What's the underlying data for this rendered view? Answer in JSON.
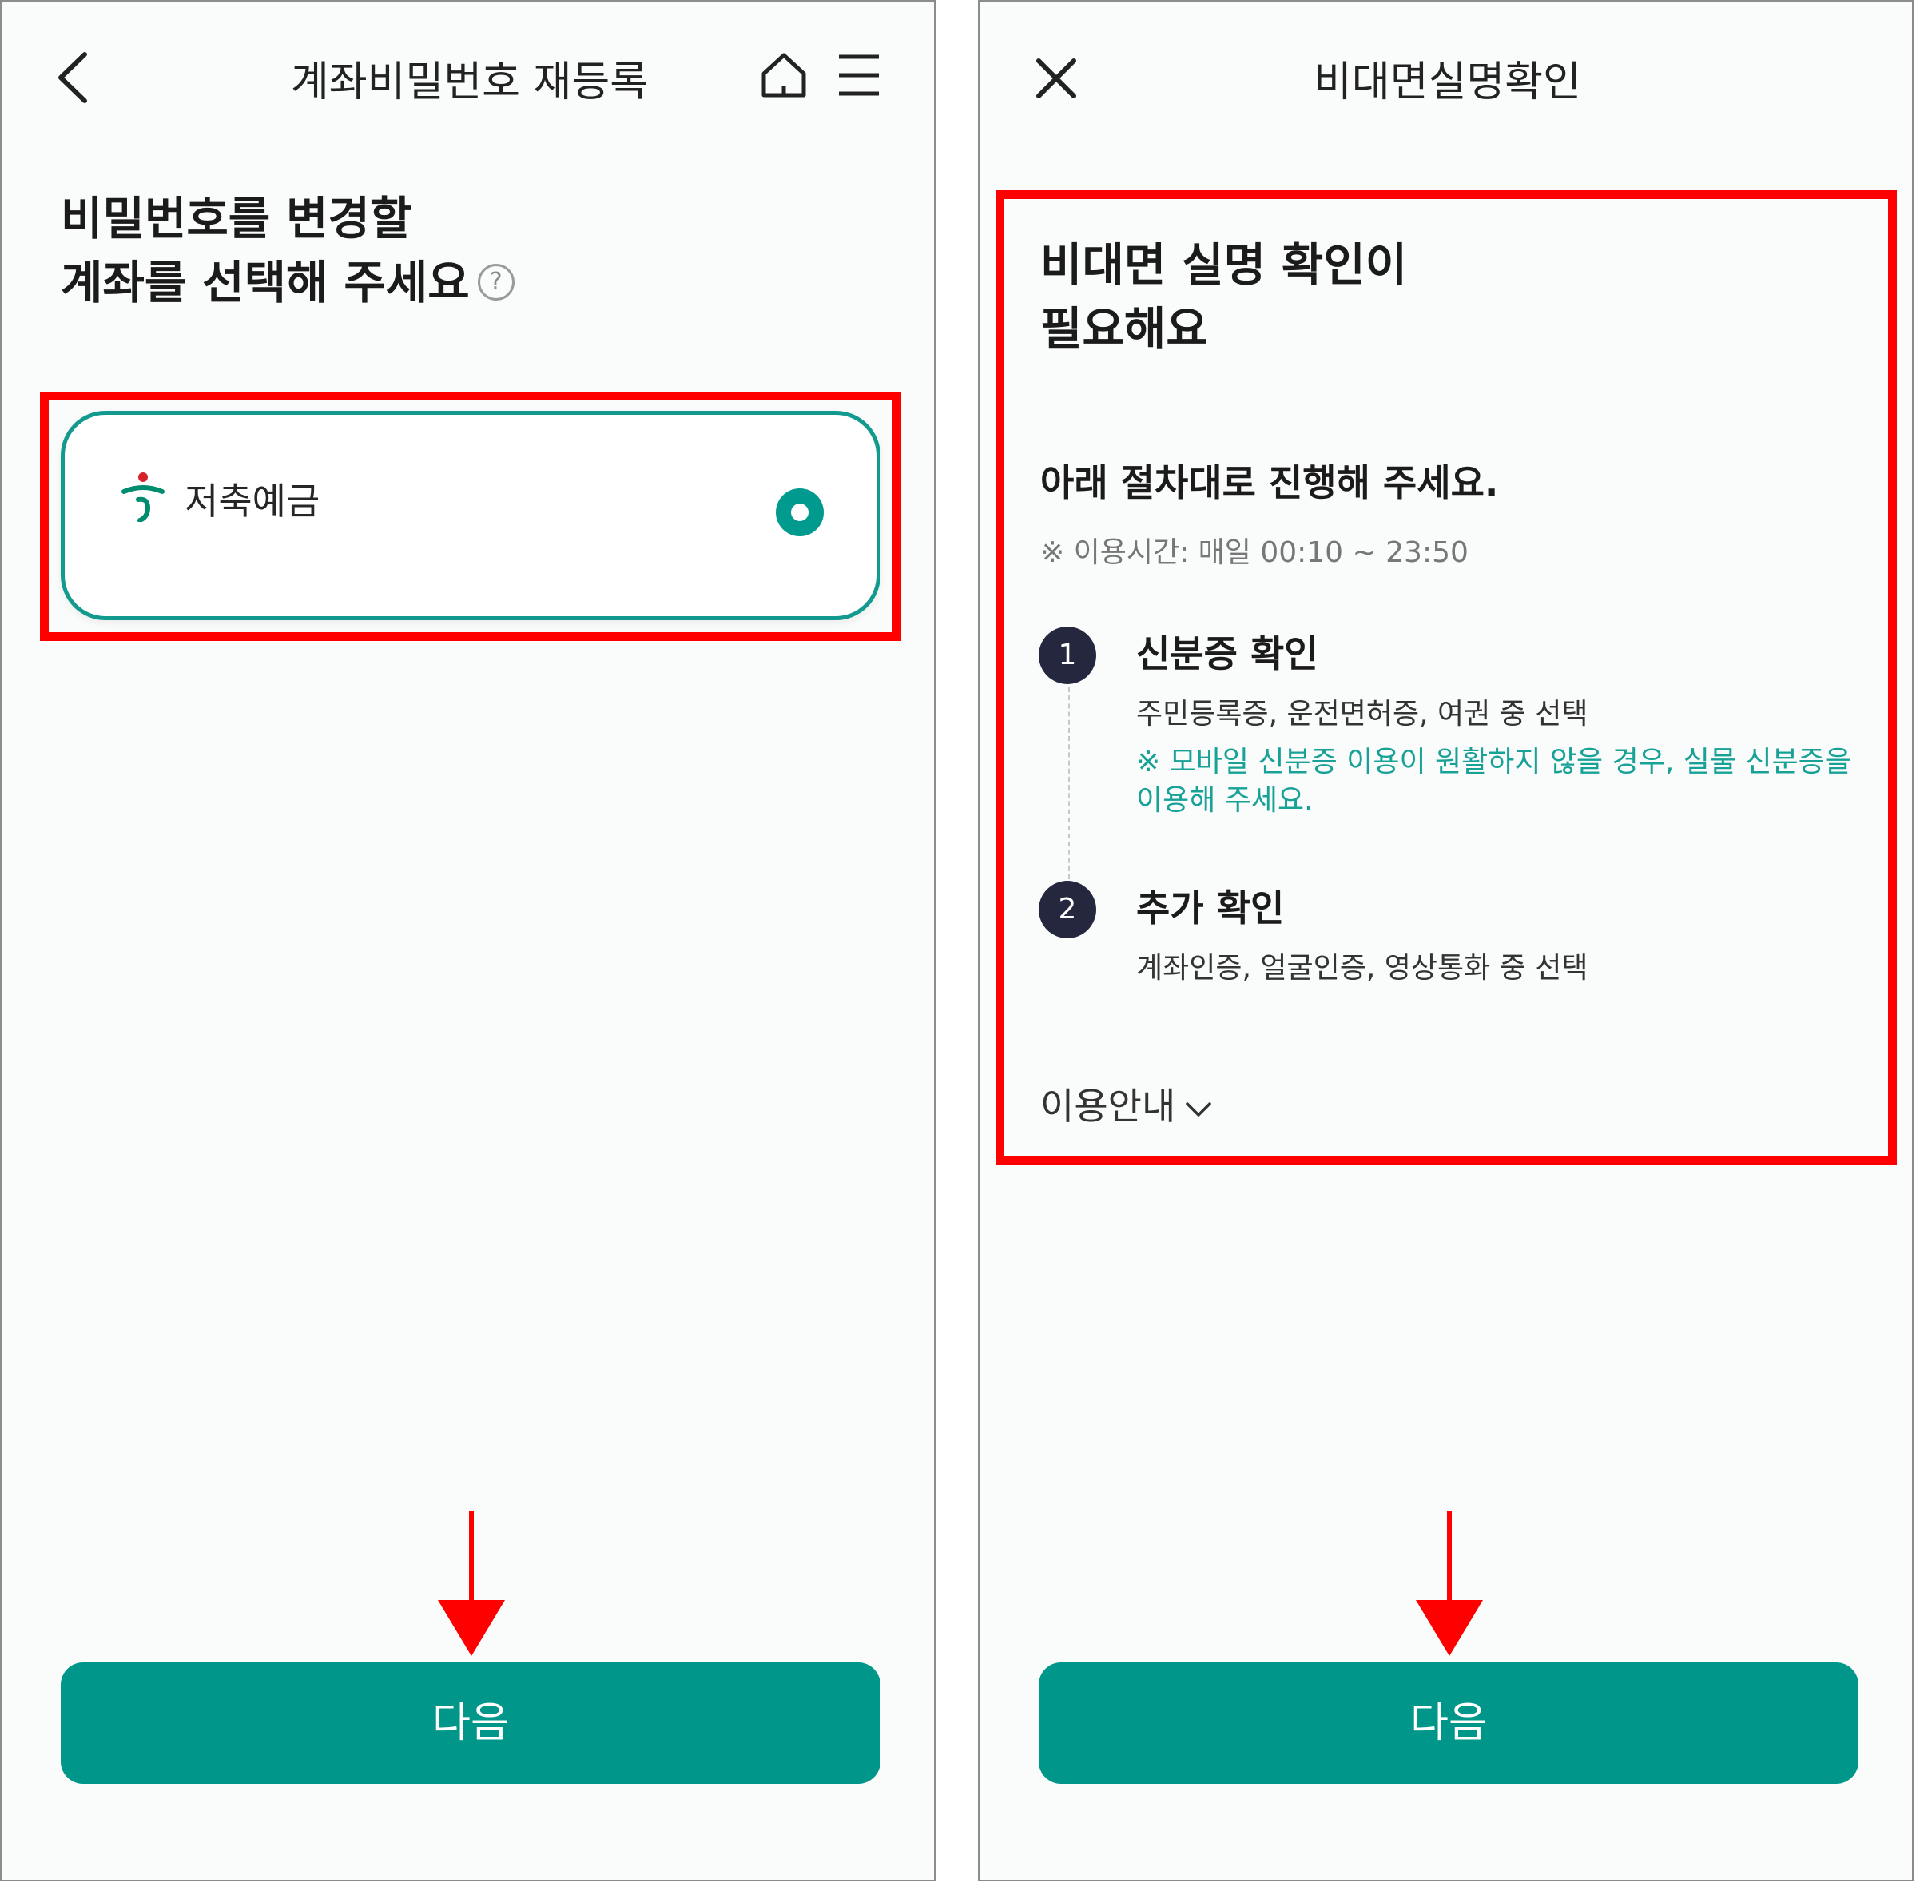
{
  "left_screen": {
    "header": {
      "title": "계좌비밀번호 재등록",
      "back_icon": "chevron-left-icon",
      "home_icon": "home-icon",
      "menu_icon": "hamburger-menu-icon"
    },
    "heading_line1": "비밀번호를 변경할",
    "heading_line2": "계좌를 선택해 주세요",
    "help_icon": "?",
    "account": {
      "name": "저축예금",
      "selected": true,
      "logo_icon": "hana-bank-logo-icon"
    },
    "next_button": "다음"
  },
  "right_screen": {
    "header": {
      "title": "비대면실명확인",
      "close_icon": "close-icon"
    },
    "heading_line1": "비대면 실명 확인이",
    "heading_line2": "필요해요",
    "sub_heading": "아래 절차대로 진행해 주세요.",
    "hours_note": "※ 이용시간: 매일 00:10 ~ 23:50",
    "steps": [
      {
        "number": "1",
        "title": "신분증 확인",
        "desc": "주민등록증, 운전면허증, 여권 중 선택",
        "warning": "※ 모바일 신분증 이용이 원활하지 않을 경우, 실물 신분증을 이용해 주세요."
      },
      {
        "number": "2",
        "title": "추가 확인",
        "desc": "계좌인증, 얼굴인증, 영상통화 중 선택"
      }
    ],
    "guide_toggle": "이용안내",
    "next_button": "다음"
  },
  "colors": {
    "accent": "#00968a",
    "highlight": "#ff0000",
    "step_badge": "#25273f",
    "warning_text": "#17a197"
  }
}
